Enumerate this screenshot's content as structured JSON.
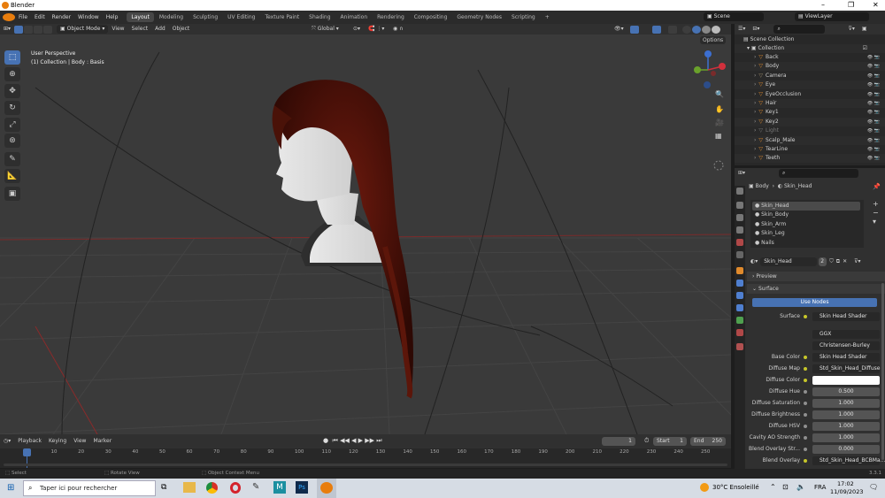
{
  "window": {
    "title": "Blender"
  },
  "menu": [
    "File",
    "Edit",
    "Render",
    "Window",
    "Help"
  ],
  "workspaces": [
    "Layout",
    "Modeling",
    "Sculpting",
    "UV Editing",
    "Texture Paint",
    "Shading",
    "Animation",
    "Rendering",
    "Compositing",
    "Geometry Nodes",
    "Scripting"
  ],
  "active_workspace": "Layout",
  "scene": "Scene",
  "view_layer": "ViewLayer",
  "viewport": {
    "mode": "Object Mode",
    "menu": [
      "View",
      "Select",
      "Add",
      "Object"
    ],
    "transform": "Global",
    "options": "Options",
    "overlay_title": "User Perspective",
    "overlay_sub": "(1) Collection | Body : Basis"
  },
  "outliner": {
    "root": "Scene Collection",
    "collection": "Collection",
    "items": [
      "Back",
      "Body",
      "Camera",
      "Eye",
      "EyeOcclusion",
      "Hair",
      "Key1",
      "Key2",
      "Light",
      "Scalp_Male",
      "TearLine",
      "Teeth"
    ]
  },
  "properties": {
    "breadcrumb_object": "Body",
    "breadcrumb_material": "Skin_Head",
    "slots": [
      "Skin_Head",
      "Skin_Body",
      "Skin_Arm",
      "Skin_Leg",
      "Nails"
    ],
    "material_name": "Skin_Head",
    "users": "2",
    "preview": "Preview",
    "surface": "Surface",
    "use_nodes": "Use Nodes",
    "rows": [
      {
        "label": "Surface",
        "value": "Skin Head Shader",
        "dot": "yellow"
      },
      {
        "label": "",
        "value": "GGX",
        "dot": ""
      },
      {
        "label": "",
        "value": "Christensen-Burley",
        "dot": ""
      },
      {
        "label": "Base Color",
        "value": "Skin Head Shader",
        "dot": "yellow"
      },
      {
        "label": "Diffuse Map",
        "value": "Std_Skin_Head_Diffuse",
        "dot": "yellow"
      },
      {
        "label": "Diffuse Color",
        "value": "",
        "dot": "yellow"
      },
      {
        "label": "Diffuse Hue",
        "value": "0.500",
        "dot": "grey"
      },
      {
        "label": "Diffuse Saturation",
        "value": "1.000",
        "dot": "grey"
      },
      {
        "label": "Diffuse Brightness",
        "value": "1.000",
        "dot": "grey"
      },
      {
        "label": "Diffuse HSV",
        "value": "1.000",
        "dot": "grey"
      },
      {
        "label": "Cavity AO Strength",
        "value": "1.000",
        "dot": "grey"
      },
      {
        "label": "Blend Overlay Str...",
        "value": "0.000",
        "dot": "grey"
      },
      {
        "label": "Blend Overlay",
        "value": "Std_Skin_Head_BCBMa...",
        "dot": "yellow"
      }
    ]
  },
  "timeline": {
    "menu": [
      "Playback",
      "Keying",
      "View",
      "Marker"
    ],
    "current_frame": "1",
    "start_label": "Start",
    "start": "1",
    "end_label": "End",
    "end": "250",
    "ticks": [
      "1",
      "10",
      "20",
      "30",
      "40",
      "50",
      "60",
      "70",
      "80",
      "90",
      "100",
      "110",
      "120",
      "130",
      "140",
      "150",
      "160",
      "170",
      "180",
      "190",
      "200",
      "210",
      "220",
      "230",
      "240",
      "250"
    ]
  },
  "statusbar": {
    "select": "Select",
    "rotate": "Rotate View",
    "context": "Object Context Menu",
    "version": "3.3.1"
  },
  "taskbar": {
    "search_placeholder": "Taper ici pour rechercher",
    "weather": "30°C Ensoleillé",
    "lang": "FRA",
    "time": "17:02",
    "date": "11/09/2023"
  }
}
